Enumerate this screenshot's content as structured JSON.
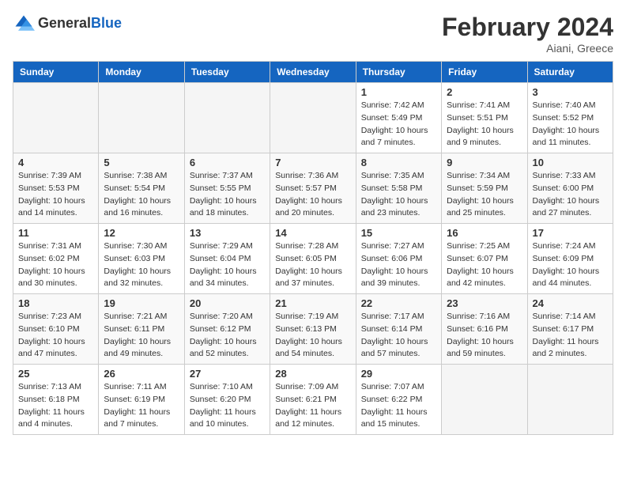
{
  "header": {
    "logo_general": "General",
    "logo_blue": "Blue",
    "title": "February 2024",
    "location": "Aiani, Greece"
  },
  "columns": [
    "Sunday",
    "Monday",
    "Tuesday",
    "Wednesday",
    "Thursday",
    "Friday",
    "Saturday"
  ],
  "weeks": [
    [
      {
        "day": "",
        "info": ""
      },
      {
        "day": "",
        "info": ""
      },
      {
        "day": "",
        "info": ""
      },
      {
        "day": "",
        "info": ""
      },
      {
        "day": "1",
        "info": "Sunrise: 7:42 AM\nSunset: 5:49 PM\nDaylight: 10 hours and 7 minutes."
      },
      {
        "day": "2",
        "info": "Sunrise: 7:41 AM\nSunset: 5:51 PM\nDaylight: 10 hours and 9 minutes."
      },
      {
        "day": "3",
        "info": "Sunrise: 7:40 AM\nSunset: 5:52 PM\nDaylight: 10 hours and 11 minutes."
      }
    ],
    [
      {
        "day": "4",
        "info": "Sunrise: 7:39 AM\nSunset: 5:53 PM\nDaylight: 10 hours and 14 minutes."
      },
      {
        "day": "5",
        "info": "Sunrise: 7:38 AM\nSunset: 5:54 PM\nDaylight: 10 hours and 16 minutes."
      },
      {
        "day": "6",
        "info": "Sunrise: 7:37 AM\nSunset: 5:55 PM\nDaylight: 10 hours and 18 minutes."
      },
      {
        "day": "7",
        "info": "Sunrise: 7:36 AM\nSunset: 5:57 PM\nDaylight: 10 hours and 20 minutes."
      },
      {
        "day": "8",
        "info": "Sunrise: 7:35 AM\nSunset: 5:58 PM\nDaylight: 10 hours and 23 minutes."
      },
      {
        "day": "9",
        "info": "Sunrise: 7:34 AM\nSunset: 5:59 PM\nDaylight: 10 hours and 25 minutes."
      },
      {
        "day": "10",
        "info": "Sunrise: 7:33 AM\nSunset: 6:00 PM\nDaylight: 10 hours and 27 minutes."
      }
    ],
    [
      {
        "day": "11",
        "info": "Sunrise: 7:31 AM\nSunset: 6:02 PM\nDaylight: 10 hours and 30 minutes."
      },
      {
        "day": "12",
        "info": "Sunrise: 7:30 AM\nSunset: 6:03 PM\nDaylight: 10 hours and 32 minutes."
      },
      {
        "day": "13",
        "info": "Sunrise: 7:29 AM\nSunset: 6:04 PM\nDaylight: 10 hours and 34 minutes."
      },
      {
        "day": "14",
        "info": "Sunrise: 7:28 AM\nSunset: 6:05 PM\nDaylight: 10 hours and 37 minutes."
      },
      {
        "day": "15",
        "info": "Sunrise: 7:27 AM\nSunset: 6:06 PM\nDaylight: 10 hours and 39 minutes."
      },
      {
        "day": "16",
        "info": "Sunrise: 7:25 AM\nSunset: 6:07 PM\nDaylight: 10 hours and 42 minutes."
      },
      {
        "day": "17",
        "info": "Sunrise: 7:24 AM\nSunset: 6:09 PM\nDaylight: 10 hours and 44 minutes."
      }
    ],
    [
      {
        "day": "18",
        "info": "Sunrise: 7:23 AM\nSunset: 6:10 PM\nDaylight: 10 hours and 47 minutes."
      },
      {
        "day": "19",
        "info": "Sunrise: 7:21 AM\nSunset: 6:11 PM\nDaylight: 10 hours and 49 minutes."
      },
      {
        "day": "20",
        "info": "Sunrise: 7:20 AM\nSunset: 6:12 PM\nDaylight: 10 hours and 52 minutes."
      },
      {
        "day": "21",
        "info": "Sunrise: 7:19 AM\nSunset: 6:13 PM\nDaylight: 10 hours and 54 minutes."
      },
      {
        "day": "22",
        "info": "Sunrise: 7:17 AM\nSunset: 6:14 PM\nDaylight: 10 hours and 57 minutes."
      },
      {
        "day": "23",
        "info": "Sunrise: 7:16 AM\nSunset: 6:16 PM\nDaylight: 10 hours and 59 minutes."
      },
      {
        "day": "24",
        "info": "Sunrise: 7:14 AM\nSunset: 6:17 PM\nDaylight: 11 hours and 2 minutes."
      }
    ],
    [
      {
        "day": "25",
        "info": "Sunrise: 7:13 AM\nSunset: 6:18 PM\nDaylight: 11 hours and 4 minutes."
      },
      {
        "day": "26",
        "info": "Sunrise: 7:11 AM\nSunset: 6:19 PM\nDaylight: 11 hours and 7 minutes."
      },
      {
        "day": "27",
        "info": "Sunrise: 7:10 AM\nSunset: 6:20 PM\nDaylight: 11 hours and 10 minutes."
      },
      {
        "day": "28",
        "info": "Sunrise: 7:09 AM\nSunset: 6:21 PM\nDaylight: 11 hours and 12 minutes."
      },
      {
        "day": "29",
        "info": "Sunrise: 7:07 AM\nSunset: 6:22 PM\nDaylight: 11 hours and 15 minutes."
      },
      {
        "day": "",
        "info": ""
      },
      {
        "day": "",
        "info": ""
      }
    ]
  ]
}
